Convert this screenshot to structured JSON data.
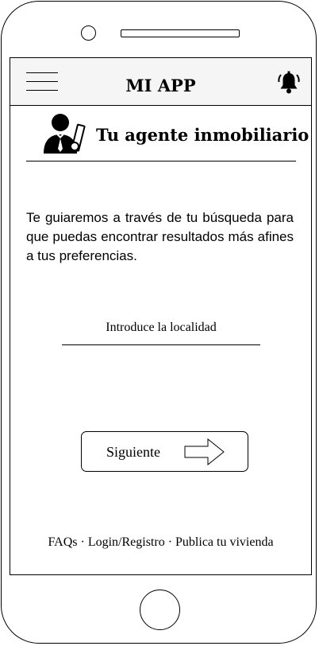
{
  "header": {
    "menu_icon": "hamburger-menu-icon",
    "title": "MI APP",
    "bell_icon": "bell-alert-icon"
  },
  "agent": {
    "icon": "agent-person-icon",
    "title": "Tu agente inmobiliario"
  },
  "intro_text": "Te guiaremos a través de tu búsqueda para que puedas encontrar resultados más afines a tus preferencias.",
  "location": {
    "placeholder": "Introduce la localidad"
  },
  "next_button": {
    "label": "Siguiente",
    "icon": "arrow-right-icon"
  },
  "footer": {
    "links": [
      "FAQs",
      "Login/Registro",
      "Publica tu vivienda"
    ],
    "separator": "·"
  }
}
